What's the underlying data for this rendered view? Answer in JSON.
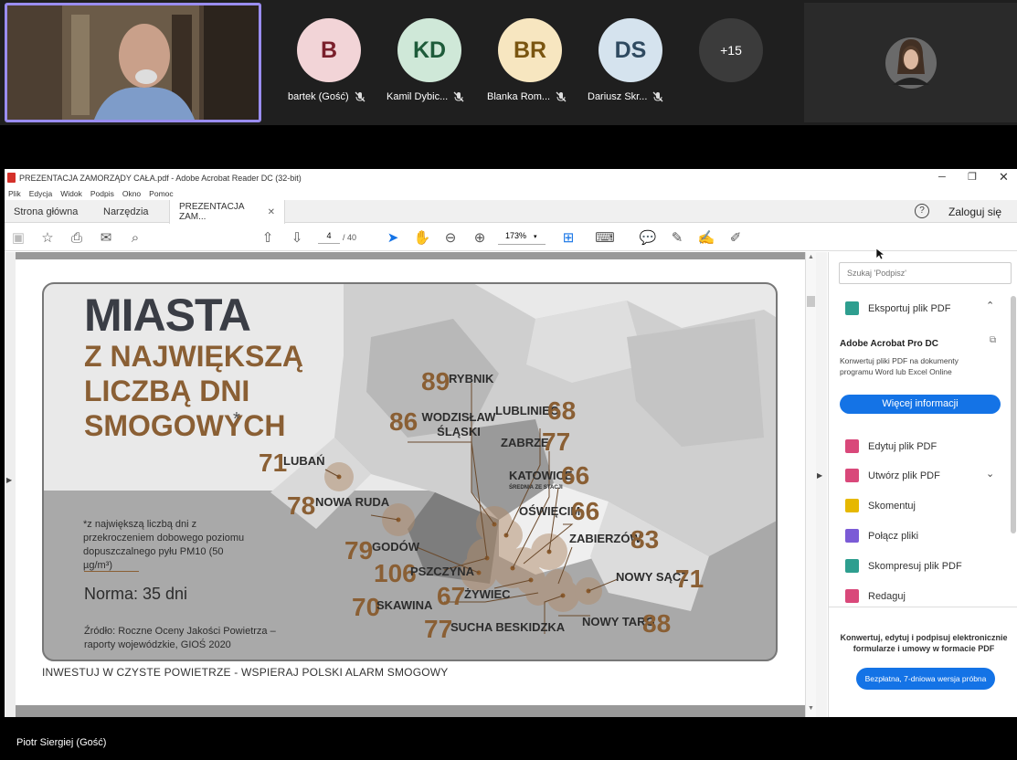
{
  "meeting": {
    "participants": [
      {
        "initials": "B",
        "name": "bartek (Gość)",
        "color": "#f2d4d7",
        "text_color": "#7a1f2b"
      },
      {
        "initials": "KD",
        "name": "Kamil Dybic...",
        "color": "#cfe8d8",
        "text_color": "#1e5b3a"
      },
      {
        "initials": "BR",
        "name": "Blanka Rom...",
        "color": "#f7e6c0",
        "text_color": "#7a5510"
      },
      {
        "initials": "DS",
        "name": "Dariusz Skr...",
        "color": "#d5e3ee",
        "text_color": "#2f4a60"
      }
    ],
    "overflow_count": "+15",
    "bottom_name": "Piotr Siergiej (Gość)"
  },
  "acrobat": {
    "window_title": "PREZENTACJA ZAMORZĄDY CAŁA.pdf - Adobe Acrobat Reader DC (32-bit)",
    "menu": [
      "Plik",
      "Edycja",
      "Widok",
      "Podpis",
      "Okno",
      "Pomoc"
    ],
    "tabs": {
      "home": "Strona główna",
      "tools": "Narzędzia",
      "doc": "PREZENTACJA ZAM..."
    },
    "login": "Zaloguj się",
    "page_current": "4",
    "page_total": "/ 40",
    "zoom": "173%",
    "search_placeholder": "Szukaj 'Podpisz'",
    "export_label": "Eksportuj plik PDF",
    "promo_title": "Adobe Acrobat Pro DC",
    "promo_text": "Konwertuj pliki PDF na dokumenty programu Word lub Excel Online",
    "promo_button": "Więcej informacji",
    "tools": [
      "Edytuj plik PDF",
      "Utwórz plik PDF",
      "Skomentuj",
      "Połącz pliki",
      "Skompresuj plik PDF",
      "Redaguj"
    ],
    "tool_colors": [
      "#d9487a",
      "#d9487a",
      "#e6b800",
      "#7b5bd6",
      "#2e9e8f",
      "#d9487a"
    ],
    "bottom_promo": "Konwertuj, edytuj i podpisuj elektronicznie formularze i umowy w formacie PDF",
    "trial_button": "Bezpłatna, 7-dniowa wersja próbna"
  },
  "slide": {
    "title1": "MIASTA",
    "title2": "Z NAJWIĘKSZĄ",
    "title3": "LICZBĄ DNI",
    "title4": "SMOGOWYCH",
    "asterisk": "*",
    "note": "*z największą liczbą dni z przekroczeniem dobowego poziomu dopuszczalnego pyłu PM10 (50 µg/m³)",
    "norma": "Norma: 35 dni",
    "source": "Źródło: Roczne Oceny Jakości Powietrza – raporty wojewódzkie, GIOŚ 2020",
    "footer": "INWESTUJ W CZYSTE POWIETRZE - WSPIERAJ POLSKI ALARM SMOGOWY",
    "srednia": "ŚREDNIA ZE STACJI",
    "cities": [
      {
        "name": "RYBNIK",
        "value": "89"
      },
      {
        "name": "WODZISŁAW ŚLĄSKI",
        "value": "86"
      },
      {
        "name": "LUBLINIEC",
        "value": "68"
      },
      {
        "name": "ZABRZE",
        "value": "77"
      },
      {
        "name": "KATOWICE",
        "value": "66"
      },
      {
        "name": "OŚWIĘCIM",
        "value": "66"
      },
      {
        "name": "LUBAŃ",
        "value": "71"
      },
      {
        "name": "NOWA RUDA",
        "value": "78"
      },
      {
        "name": "GODÓW",
        "value": "79"
      },
      {
        "name": "PSZCZYNA",
        "value": "106"
      },
      {
        "name": "ŻYWIEC",
        "value": "67"
      },
      {
        "name": "SKAWINA",
        "value": "70"
      },
      {
        "name": "SUCHA BESKIDZKA",
        "value": "77"
      },
      {
        "name": "ZABIERZÓW",
        "value": "83"
      },
      {
        "name": "NOWY SĄCZ",
        "value": "71"
      },
      {
        "name": "NOWY TARG",
        "value": "88"
      }
    ]
  }
}
